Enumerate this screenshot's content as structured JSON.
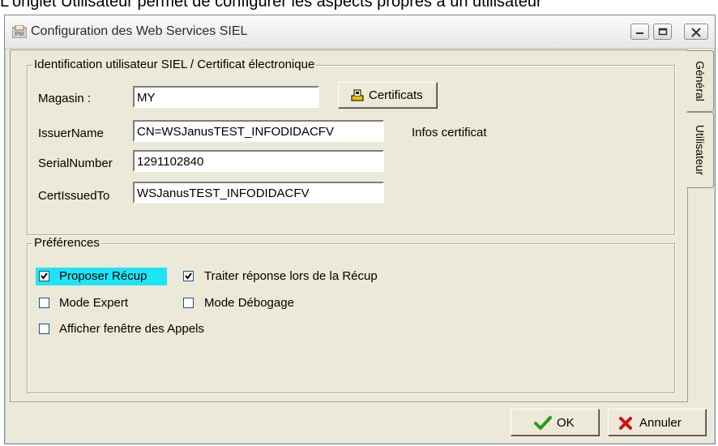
{
  "caption": "L'onglet Utilisateur permet de configurer les aspects propres à un utilisateur",
  "window": {
    "title": "Configuration des Web Services SIEL",
    "app_icon_text": "PM"
  },
  "tabs": [
    {
      "label": "Général",
      "active": false
    },
    {
      "label": "Utilisateur",
      "active": true
    }
  ],
  "identification": {
    "group_title": "Identification utilisateur SIEL / Certificat électronique",
    "magasin_label": "Magasin :",
    "magasin_value": "MY",
    "certificats_button": "Certificats",
    "issuer_label": "IssuerName",
    "issuer_value": "CN=WSJanusTEST_INFODIDACFV",
    "infos_label": "Infos certificat",
    "serial_label": "SerialNumber",
    "serial_value": "1291102840",
    "issuedto_label": "CertIssuedTo",
    "issuedto_value": "WSJanusTEST_INFODIDACFV"
  },
  "preferences": {
    "group_title": "Préférences",
    "options": [
      {
        "label": "Proposer Récup",
        "checked": true,
        "highlighted": true
      },
      {
        "label": "Traiter réponse lors de la Récup",
        "checked": true,
        "highlighted": false
      },
      {
        "label": "Mode Expert",
        "checked": false,
        "highlighted": false
      },
      {
        "label": "Mode Débogage",
        "checked": false,
        "highlighted": false
      },
      {
        "label": "Afficher fenêtre des Appels",
        "checked": false,
        "highlighted": false
      }
    ],
    "highlight_color": "#1ee5f5"
  },
  "footer": {
    "ok_label": "OK",
    "cancel_label": "Annuler",
    "ok_icon": "green-check-icon",
    "cancel_icon": "red-x-icon"
  }
}
